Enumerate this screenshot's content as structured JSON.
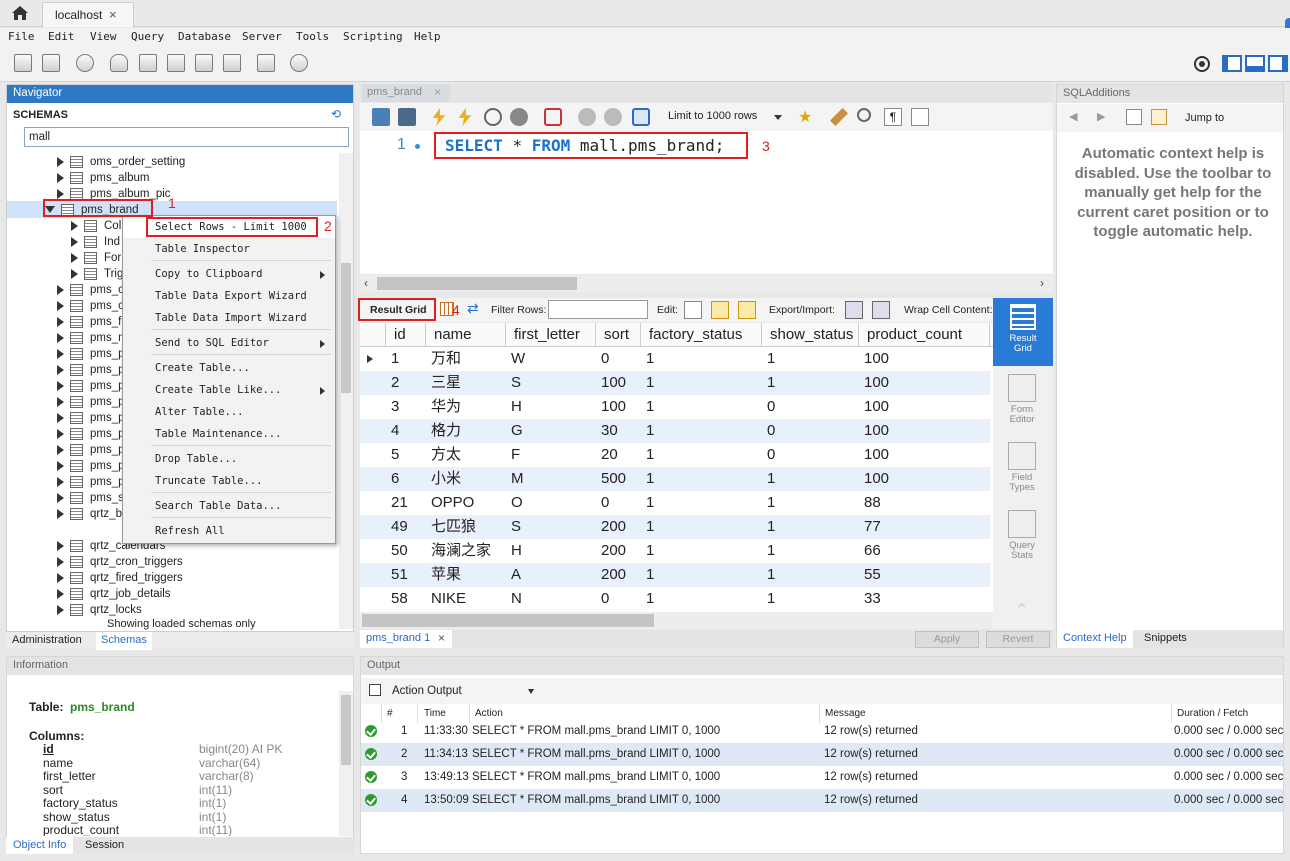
{
  "tabs": {
    "home": "home-icon",
    "connection": "localhost",
    "close": "×"
  },
  "menu": [
    "File",
    "Edit",
    "View",
    "Query",
    "Database",
    "Server",
    "Tools",
    "Scripting",
    "Help"
  ],
  "navigator": {
    "title": "Navigator",
    "schemas_label": "SCHEMAS",
    "filter_value": "mall",
    "tables_before": [
      "oms_order_setting",
      "pms_album",
      "pms_album_pic"
    ],
    "selected_table": "pms_brand",
    "children": [
      "Col",
      "Ind",
      "For",
      "Trig"
    ],
    "tables_after_partial": [
      "pms_cc",
      "pms_cc",
      "pms_fe",
      "pms_m",
      "pms_pr",
      "pms_pr",
      "pms_pr",
      "pms_pr",
      "pms_pr",
      "pms_pr",
      "pms_pr",
      "pms_pr",
      "pms_pr",
      "pms_sk",
      "qrtz_bl"
    ],
    "tables_after": [
      "qrtz_calendars",
      "qrtz_cron_triggers",
      "qrtz_fired_triggers",
      "qrtz_job_details",
      "qrtz_locks"
    ],
    "footer_note": "Showing loaded schemas only",
    "bottom_tabs": [
      "Administration",
      "Schemas"
    ]
  },
  "context_menu": [
    {
      "label": "Select Rows - Limit 1000",
      "submenu": false
    },
    {
      "label": "Table Inspector",
      "submenu": false
    },
    {
      "label": "Copy to Clipboard",
      "submenu": true
    },
    {
      "label": "Table Data Export Wizard",
      "submenu": false
    },
    {
      "label": "Table Data Import Wizard",
      "submenu": false
    },
    {
      "label": "Send to SQL Editor",
      "submenu": true
    },
    {
      "label": "Create Table...",
      "submenu": false
    },
    {
      "label": "Create Table Like...",
      "submenu": true
    },
    {
      "label": "Alter Table...",
      "submenu": false
    },
    {
      "label": "Table Maintenance...",
      "submenu": false
    },
    {
      "label": "Drop Table...",
      "submenu": false
    },
    {
      "label": "Truncate Table...",
      "submenu": false
    },
    {
      "label": "Search Table Data...",
      "submenu": false
    },
    {
      "label": "Refresh All",
      "submenu": false
    }
  ],
  "annotations": {
    "n1": "1",
    "n2": "2",
    "n3": "3",
    "n4": "4"
  },
  "editor": {
    "tab": "pms_brand",
    "limit_label": "Limit to 1000 rows",
    "line_no": "1",
    "sql": {
      "kw1": "SELECT",
      "star": "*",
      "kw2": "FROM",
      "rest": "mall.pms_brand;"
    }
  },
  "result_toolbar": {
    "result_grid": "Result Grid",
    "filter_rows": "Filter Rows:",
    "edit": "Edit:",
    "export_import": "Export/Import:",
    "wrap": "Wrap Cell Content:"
  },
  "grid": {
    "columns": [
      "id",
      "name",
      "first_letter",
      "sort",
      "factory_status",
      "show_status",
      "product_count"
    ],
    "rows": [
      [
        "1",
        "万和",
        "W",
        "0",
        "1",
        "1",
        "100"
      ],
      [
        "2",
        "三星",
        "S",
        "100",
        "1",
        "1",
        "100"
      ],
      [
        "3",
        "华为",
        "H",
        "100",
        "1",
        "0",
        "100"
      ],
      [
        "4",
        "格力",
        "G",
        "30",
        "1",
        "0",
        "100"
      ],
      [
        "5",
        "方太",
        "F",
        "20",
        "1",
        "0",
        "100"
      ],
      [
        "6",
        "小米",
        "M",
        "500",
        "1",
        "1",
        "100"
      ],
      [
        "21",
        "OPPO",
        "O",
        "0",
        "1",
        "1",
        "88"
      ],
      [
        "49",
        "七匹狼",
        "S",
        "200",
        "1",
        "1",
        "77"
      ],
      [
        "50",
        "海澜之家",
        "H",
        "200",
        "1",
        "1",
        "66"
      ],
      [
        "51",
        "苹果",
        "A",
        "200",
        "1",
        "1",
        "55"
      ],
      [
        "58",
        "NIKE",
        "N",
        "0",
        "1",
        "1",
        "33"
      ]
    ]
  },
  "side_panel": [
    "Result Grid",
    "Form Editor",
    "Field Types",
    "Query Stats"
  ],
  "result_tab": "pms_brand 1",
  "buttons": {
    "apply": "Apply",
    "revert": "Revert"
  },
  "sql_additions": {
    "title": "SQLAdditions",
    "jump_to": "Jump to",
    "help_text": "Automatic context help is disabled. Use the toolbar to manually get help for the current caret position or to toggle automatic help.",
    "tabs": [
      "Context Help",
      "Snippets"
    ]
  },
  "information": {
    "title": "Information",
    "table_label": "Table:",
    "table_name": "pms_brand",
    "columns_label": "Columns:",
    "columns": [
      {
        "name": "id",
        "type": "bigint(20) AI PK"
      },
      {
        "name": "name",
        "type": "varchar(64)"
      },
      {
        "name": "first_letter",
        "type": "varchar(8)"
      },
      {
        "name": "sort",
        "type": "int(11)"
      },
      {
        "name": "factory_status",
        "type": "int(1)"
      },
      {
        "name": "show_status",
        "type": "int(1)"
      },
      {
        "name": "product_count",
        "type": "int(11)"
      }
    ],
    "tabs": [
      "Object Info",
      "Session"
    ]
  },
  "output": {
    "title": "Output",
    "selector": "Action Output",
    "headers": [
      "#",
      "Time",
      "Action",
      "Message",
      "Duration / Fetch"
    ],
    "rows": [
      [
        "1",
        "11:33:30",
        "SELECT * FROM mall.pms_brand LIMIT 0, 1000",
        "12 row(s) returned",
        "0.000 sec / 0.000 sec"
      ],
      [
        "2",
        "11:34:13",
        "SELECT * FROM mall.pms_brand LIMIT 0, 1000",
        "12 row(s) returned",
        "0.000 sec / 0.000 sec"
      ],
      [
        "3",
        "13:49:13",
        "SELECT * FROM mall.pms_brand LIMIT 0, 1000",
        "12 row(s) returned",
        "0.000 sec / 0.000 sec"
      ],
      [
        "4",
        "13:50:09",
        "SELECT * FROM mall.pms_brand LIMIT 0, 1000",
        "12 row(s) returned",
        "0.000 sec / 0.000 sec"
      ]
    ]
  }
}
